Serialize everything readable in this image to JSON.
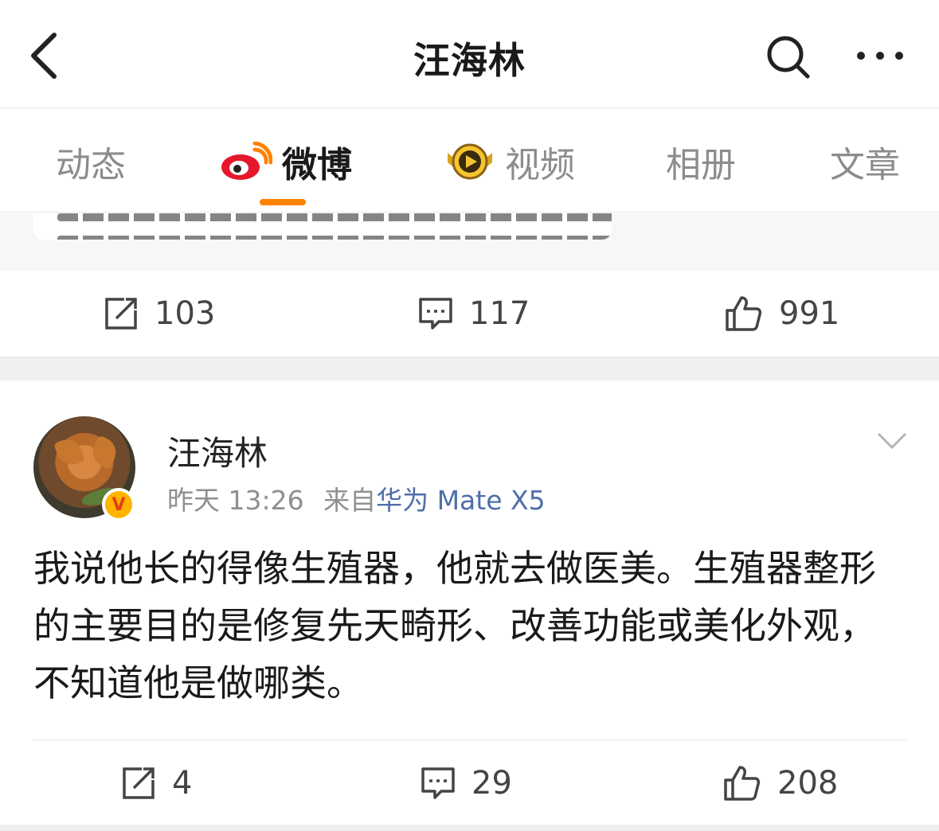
{
  "header": {
    "title": "汪海林"
  },
  "tabs": [
    {
      "label": "动态",
      "icon": ""
    },
    {
      "label": "微博",
      "icon": "weibo-logo-icon"
    },
    {
      "label": "视频",
      "icon": "video-badge-icon"
    },
    {
      "label": "相册",
      "icon": ""
    },
    {
      "label": "文章",
      "icon": ""
    }
  ],
  "previous_post": {
    "repost_count": "103",
    "comment_count": "117",
    "like_count": "991"
  },
  "post": {
    "author": "汪海林",
    "time": "昨天 13:26",
    "from_label": "来自",
    "source": "华为 Mate X5",
    "badge": "V",
    "text": "我说他长的得像生殖器，他就去做医美。生殖器整形的主要目的是修复先天畸形、改善功能或美化外观，不知道他是做哪类。",
    "repost_count": "4",
    "comment_count": "29",
    "like_count": "208"
  },
  "colors": {
    "accent": "#ff8200",
    "link": "#4f6fa8",
    "muted": "#8c8c8c"
  }
}
